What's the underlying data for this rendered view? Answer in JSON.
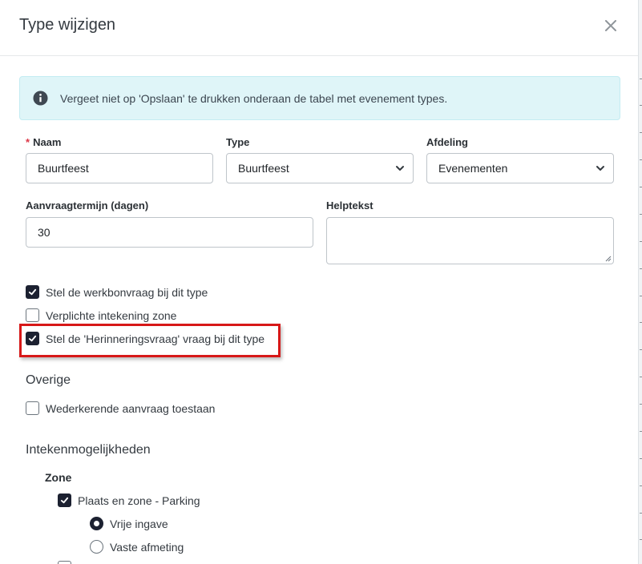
{
  "modal": {
    "title": "Type wijzigen",
    "close_icon": "close-icon"
  },
  "alert": {
    "icon": "info-circle-icon",
    "text": "Vergeet niet op 'Opslaan' te drukken onderaan de tabel met evenement types."
  },
  "form": {
    "naam": {
      "required_mark": "*",
      "label": "Naam",
      "value": "Buurtfeest"
    },
    "type": {
      "label": "Type",
      "selected": "Buurtfeest"
    },
    "afdeling": {
      "label": "Afdeling",
      "selected": "Evenementen"
    },
    "aanvraagtermijn": {
      "label": "Aanvraagtermijn (dagen)",
      "value": "30"
    },
    "helptekst": {
      "label": "Helptekst",
      "value": ""
    }
  },
  "checkboxes": [
    {
      "label": "Stel de werkbonvraag bij dit type",
      "checked": true
    },
    {
      "label": "Verplichte intekening zone",
      "checked": false
    },
    {
      "label": "Stel de 'Herinneringsvraag' vraag bij dit type",
      "checked": true
    }
  ],
  "overige": {
    "title": "Overige",
    "items": [
      {
        "label": "Wederkerende aanvraag toestaan",
        "checked": false
      }
    ]
  },
  "intekenmogelijkheden": {
    "title": "Intekenmogelijkheden",
    "zone": {
      "title": "Zone",
      "option": {
        "label": "Plaats en zone - Parking",
        "checked": true
      },
      "radios": [
        {
          "label": "Vrije ingave",
          "checked": true
        },
        {
          "label": "Vaste afmeting",
          "checked": false
        }
      ]
    }
  },
  "colors": {
    "accent_dark": "#1c2131",
    "alert_bg": "#dff5f8",
    "highlight_red": "#d71818",
    "required_red": "#dc3545"
  }
}
